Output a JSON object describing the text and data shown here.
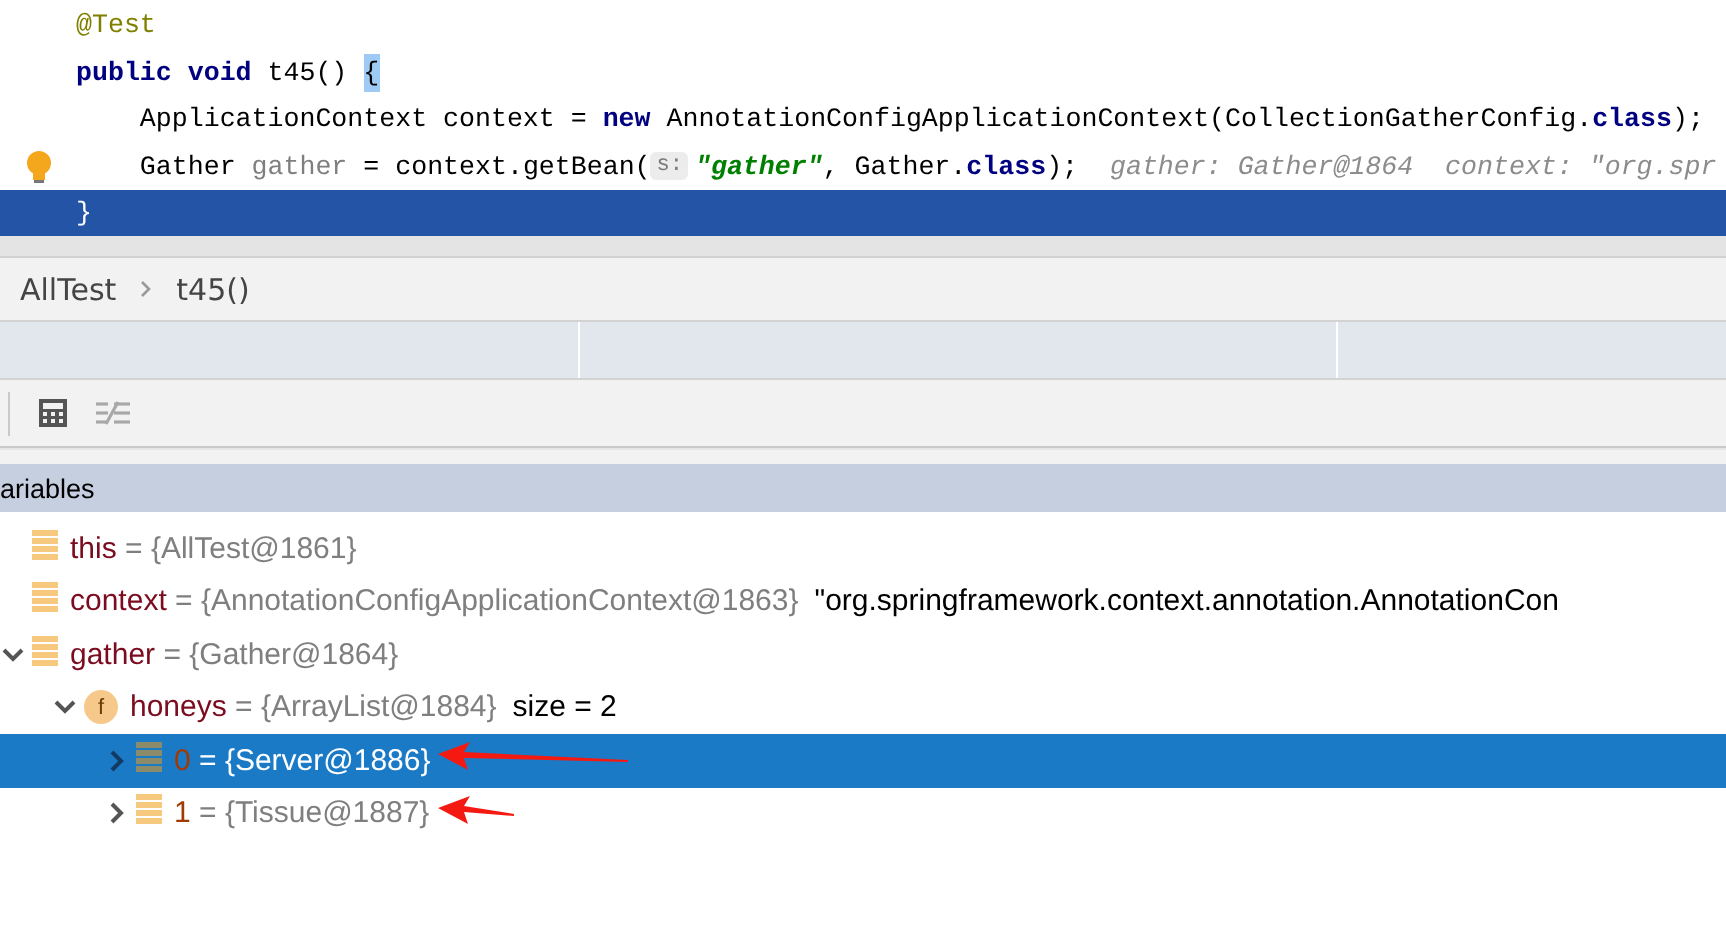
{
  "editor": {
    "lines": [
      {
        "tokens": [
          {
            "kind": "annotation",
            "text": "@Test"
          }
        ]
      },
      {
        "tokens": [
          {
            "kind": "keyword",
            "text": "public void"
          },
          {
            "kind": "plain",
            "text": " t45() "
          },
          {
            "kind": "brace-match",
            "text": "{"
          }
        ]
      },
      {
        "tokens": [
          {
            "kind": "plain",
            "text": "    ApplicationContext context = "
          },
          {
            "kind": "keyword",
            "text": "new"
          },
          {
            "kind": "plain",
            "text": " AnnotationConfigApplicationContext(CollectionGatherConfig."
          },
          {
            "kind": "keyword",
            "text": "class"
          },
          {
            "kind": "plain",
            "text": ");"
          }
        ]
      },
      {
        "bulb": true,
        "tokens": [
          {
            "kind": "plain",
            "text": "    Gather "
          },
          {
            "kind": "unused",
            "text": "gather"
          },
          {
            "kind": "plain",
            "text": " = context.getBean("
          },
          {
            "kind": "param-hint",
            "text": "s:"
          },
          {
            "kind": "string",
            "text": "\"gather\""
          },
          {
            "kind": "plain",
            "text": ", Gather."
          },
          {
            "kind": "keyword",
            "text": "class"
          },
          {
            "kind": "plain",
            "text": ");  "
          },
          {
            "kind": "inline-value",
            "text": "gather: Gather@1864  context: \"org.spr"
          }
        ]
      },
      {
        "current": true,
        "tokens": [
          {
            "kind": "plain",
            "text": "}"
          }
        ]
      }
    ]
  },
  "breadcrumb": [
    "AllTest",
    "t45()"
  ],
  "variables": {
    "title": "ariables",
    "tree": [
      {
        "kind": "variable",
        "name": "this",
        "value": "= {AllTest@1861}"
      },
      {
        "kind": "variable",
        "name": "context",
        "value": "= {AnnotationConfigApplicationContext@1863}",
        "extra": "\"org.springframework.context.annotation.AnnotationCon"
      },
      {
        "kind": "variable",
        "name": "gather",
        "value": "= {Gather@1864}",
        "expanded": true,
        "children": [
          {
            "kind": "field",
            "badge": "f",
            "name": "honeys",
            "value": "= {ArrayList@1884}",
            "extra": "size = 2",
            "expanded": true,
            "children": [
              {
                "kind": "element",
                "name": "0",
                "value": "= {Server@1886}",
                "expanded": false,
                "selected": true,
                "marked": true
              },
              {
                "kind": "element",
                "name": "1",
                "value": "= {Tissue@1887}",
                "expanded": false,
                "selected": false,
                "marked": true
              }
            ]
          }
        ]
      }
    ]
  }
}
